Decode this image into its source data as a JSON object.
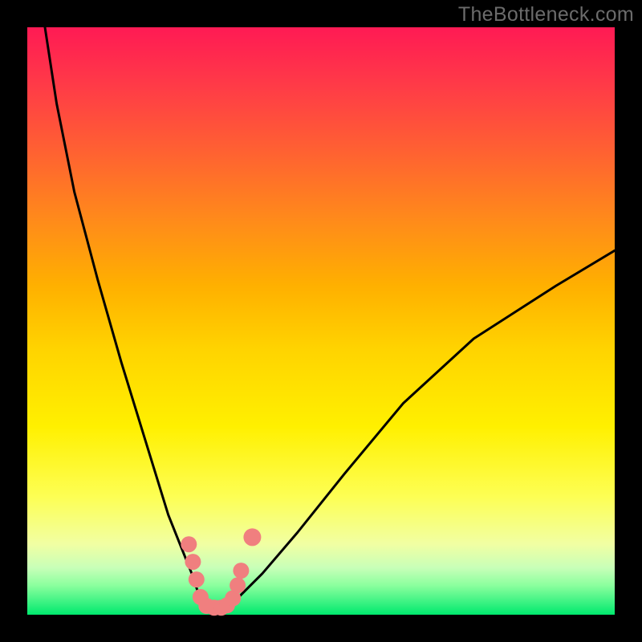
{
  "watermark": "TheBottleneck.com",
  "chart_data": {
    "type": "line",
    "title": "",
    "xlabel": "",
    "ylabel": "",
    "xlim": [
      0,
      100
    ],
    "ylim": [
      0,
      100
    ],
    "series": [
      {
        "name": "bottleneck-curve",
        "x": [
          3,
          5,
          8,
          12,
          16,
          20,
          24,
          26,
          28,
          29,
          30,
          31,
          32,
          33,
          34,
          36,
          40,
          46,
          54,
          64,
          76,
          90,
          100
        ],
        "values": [
          100,
          87,
          72,
          57,
          43,
          30,
          17,
          12,
          7,
          4,
          2,
          1,
          1,
          1,
          2,
          3,
          7,
          14,
          24,
          36,
          47,
          56,
          62
        ]
      }
    ],
    "markers": {
      "name": "highlighted-points",
      "color": "#f07f7f",
      "points": [
        {
          "x": 27.5,
          "y": 12,
          "r": 10
        },
        {
          "x": 28.2,
          "y": 9,
          "r": 10
        },
        {
          "x": 28.8,
          "y": 6,
          "r": 10
        },
        {
          "x": 29.5,
          "y": 3,
          "r": 10
        },
        {
          "x": 30.5,
          "y": 1.5,
          "r": 10
        },
        {
          "x": 31.8,
          "y": 1.2,
          "r": 10
        },
        {
          "x": 33.0,
          "y": 1.2,
          "r": 10
        },
        {
          "x": 34.0,
          "y": 1.6,
          "r": 10
        },
        {
          "x": 35.0,
          "y": 2.8,
          "r": 10
        },
        {
          "x": 35.8,
          "y": 5.0,
          "r": 10
        },
        {
          "x": 36.4,
          "y": 7.5,
          "r": 10
        },
        {
          "x": 38.3,
          "y": 13.2,
          "r": 11
        }
      ]
    }
  }
}
